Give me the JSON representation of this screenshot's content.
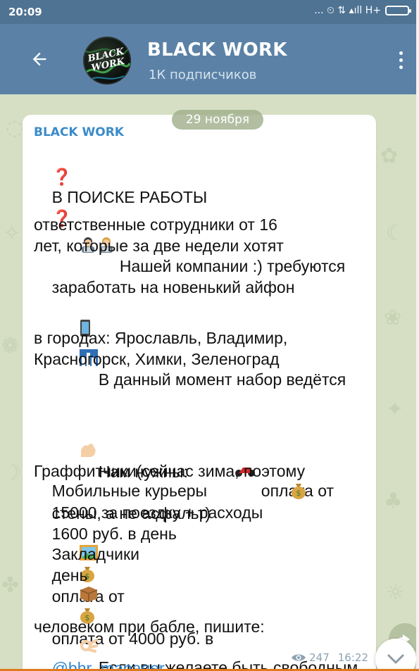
{
  "status_bar": {
    "time": "20:09",
    "icons_text": "... ⏲ ⇅ ▴ıll H+"
  },
  "header": {
    "title": "BLACK WORK",
    "subtitle": "1К подписчиков",
    "avatar_text": "BLACK WORK"
  },
  "message": {
    "date": "29 ноября",
    "sender": "BLACK WORK",
    "heading": "В ПОИСКЕ РАБОТЫ",
    "p1_l1": "Нашей компании :) требуются",
    "p1_l2": "ответственные сотрудники от 16",
    "p1_l3": "лет, которые за две недели хотят",
    "p1_l4": "заработать на новенький айфон",
    "p2_l1": "В данный момент набор ведётся",
    "p2_l2": "в городах: Ярославль, Владимир,",
    "p2_l3": "Красногорск, Химки, Зеленоград",
    "p3_l1": "Нам нужны:",
    "p3_l2": "Мобильные курьеры",
    "p3_l2b": "оплата от",
    "p3_l3": "15000 за поездку + расходы",
    "p3_l4": "Граффитчики(сейчас зима, поэтому",
    "p3_l5": "стены, а не асфальт)",
    "p3_l5b": "оплата от",
    "p3_l6": "1600 руб. в день",
    "p3_l7": "Закладчики",
    "p3_l7b": "оплата от 4000 руб. в",
    "p3_l8": "день",
    "p4_l1": "Если вы желаете быть свободным",
    "p4_l2": "человеком при бабле, пишите:",
    "link": "@bhr_manager",
    "views": "247",
    "time": "16:22"
  },
  "icons": {
    "back": "arrow-left-icon",
    "menu": "three-dots-vertical-icon",
    "views": "eye-icon",
    "scroll": "chevron-down-icon"
  },
  "colors": {
    "header": "#5b82a6",
    "statusbar": "#4f7393",
    "sender": "#3a8bc9",
    "link": "#2e86d1",
    "chat_bg": "#d6dfc4",
    "accent_red": "#e0242b"
  }
}
